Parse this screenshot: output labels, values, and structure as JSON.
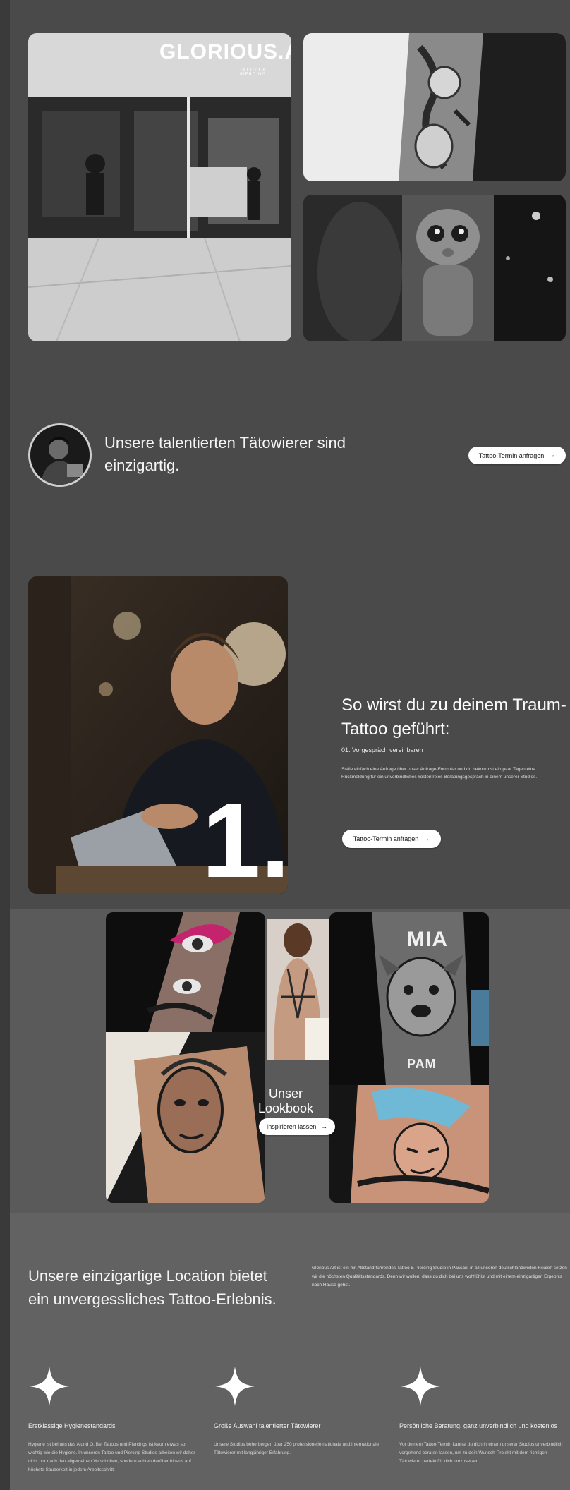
{
  "hero": {
    "store_sign": "GLORIOUS.A",
    "store_sign_sub": "TATTOO & PIERCING"
  },
  "artists": {
    "tagline": "Unsere talentierten Tätowierer sind einzigartig.",
    "cta_label": "Tattoo-Termin anfragen"
  },
  "steps": {
    "title": "So wirst du zu deinem Traum-Tattoo geführt:",
    "step_label": "01. Vorgespräch vereinbaren",
    "step_description": "Stelle einfach eine Anfrage über unser Anfrage-Formular und du bekommst ein paar Tagen eine Rückmeldung für ein unverbindliches kostenfreies Beratungsgespräch in einem unserer Studios.",
    "step_number": "1.",
    "cta_label": "Tattoo-Termin anfragen"
  },
  "lookbook": {
    "title": "Unser Lookbook",
    "cta_label": "Inspirieren lassen",
    "dog_tattoo_text_top": "MIA",
    "dog_tattoo_text_bottom": "PAM"
  },
  "location": {
    "title": "Unsere einzigartige Location bietet ein unvergessliches Tattoo-Erlebnis.",
    "description": "Glorious Art ist ein mit Abstand führendes Tattoo & Piercing Studio in Passau, in all unseren deutschlandweiten Filialen setzen wir die höchsten Qualitätsstandards. Denn wir wollen, dass du dich bei uns wohlfühlst und mit einem einzigartigen Ergebnis nach Hause gehst.",
    "features": [
      {
        "icon": "sparkle-icon",
        "title": "Erstklassige Hygienestandards",
        "description": "Hygiene ist bei uns das A und O. Bei Tattoos und Piercings ist kaum etwas so wichtig wie die Hygiene. In unseren Tattoo und Piercing Studios arbeiten wir daher nicht nur nach den allgemeinen Vorschriften, sondern achten darüber hinaus auf höchste Sauberkeit in jedem Arbeitsschritt."
      },
      {
        "icon": "sparkle-icon",
        "title": "Große Auswahl talentierter Tätowierer",
        "description": "Unsere Studios beherbergen über 250 professionelle nationale und internationale Tätowierer mit langjähriger Erfahrung."
      },
      {
        "icon": "sparkle-icon",
        "title": "Persönliche Beratung, ganz unverbindlich und kostenlos",
        "description": "Vor deinem Tattoo-Termin kannst du dich in einem unserer Studios unverbindlich vorgehend beraten lassen, um zu dein Wunsch-Projekt mit dem richtigen Tätowierer perfekt für dich umzusetzen."
      }
    ]
  },
  "colors": {
    "page_background": "#4a4a4a",
    "band_background": "#5a5a5a",
    "button_background": "#ffffff",
    "text_light": "#f5f5f5"
  }
}
